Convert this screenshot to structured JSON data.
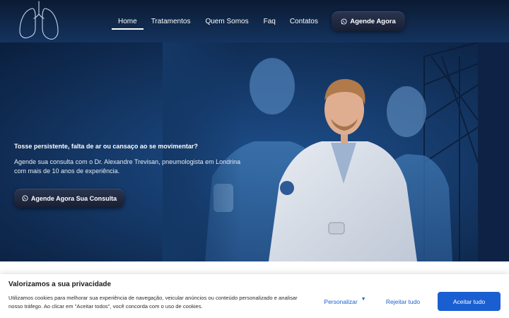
{
  "header": {
    "logo_icon": "lungs-outline-icon",
    "nav": [
      {
        "label": "Home",
        "active": true
      },
      {
        "label": "Tratamentos"
      },
      {
        "label": "Quem Somos"
      },
      {
        "label": "Faq"
      },
      {
        "label": "Contatos"
      }
    ],
    "cta": {
      "label": "Agende Agora",
      "icon": "whatsapp-icon"
    }
  },
  "hero": {
    "headline": "Tosse persistente, falta de ar ou cansaço ao se movimentar?",
    "description": "Agende sua consulta com o Dr. Alexandre Trevisan, pneumologista em Londrina com mais de 10 anos de experiência.",
    "cta": {
      "label": "Agende Agora Sua Consulta",
      "icon": "whatsapp-icon"
    },
    "image": "doctor-photo-composite"
  },
  "cookie_banner": {
    "title": "Valorizamos a sua privacidade",
    "text": "Utilizamos cookies para melhorar sua experiência de navegação, veicular anúncios ou conteúdo personalizado e analisar nosso tráfego. Ao clicar em \"Aceitar todos\", você concorda com o uso de cookies.",
    "personalize_label": "Personalizar",
    "reject_label": "Rejeitar tudo",
    "accept_label": "Aceitar tudo"
  },
  "colors": {
    "header_dark": "#0b1a33",
    "hero_blue": "#1e4f8c",
    "accent_blue": "#1a5fd1"
  }
}
